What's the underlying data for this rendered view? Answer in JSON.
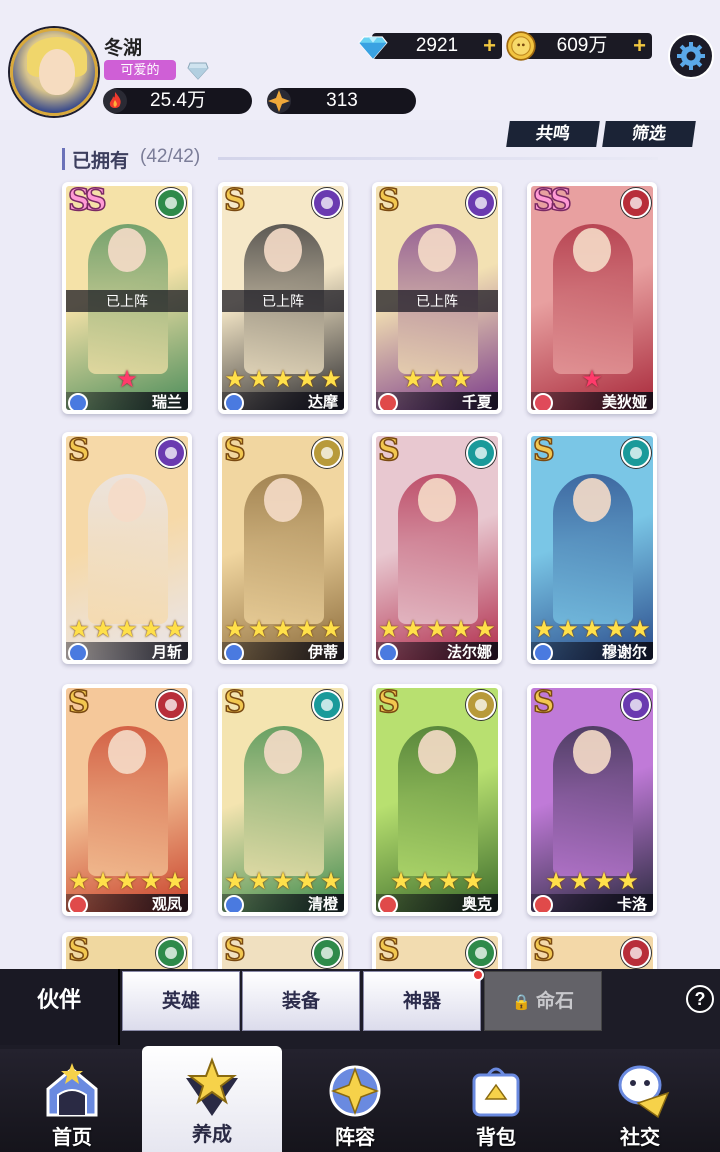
{
  "header": {
    "player_name": "冬湖",
    "player_title": "可爱的",
    "power": "25.4万",
    "rank": "313",
    "gems": "2921",
    "gold": "609万"
  },
  "actions": {
    "resonate": "共鸣",
    "filter": "筛选"
  },
  "owned": {
    "label": "已拥有",
    "count": "(42/42)"
  },
  "heroes": [
    {
      "name": "瑞兰",
      "rarity": "SS",
      "faction": "nature",
      "deployed": "已上阵",
      "stars": 1,
      "star_color": "red",
      "colors": [
        "#f5e2a8",
        "#4a8c5a"
      ]
    },
    {
      "name": "达摩",
      "rarity": "S",
      "faction": "moon",
      "deployed": "已上阵",
      "stars": 5,
      "star_color": "gold",
      "colors": [
        "#f6e8c8",
        "#2a2a2e"
      ]
    },
    {
      "name": "千夏",
      "rarity": "S",
      "faction": "moon",
      "deployed": "已上阵",
      "stars": 3,
      "star_color": "gold",
      "colors": [
        "#f3e1b3",
        "#7a3a8a"
      ]
    },
    {
      "name": "美狄娅",
      "rarity": "SS",
      "faction": "fire",
      "deployed": "",
      "stars": 1,
      "star_color": "red",
      "colors": [
        "#e8a0a0",
        "#a8283a"
      ]
    },
    {
      "name": "月斩",
      "rarity": "S",
      "faction": "moon",
      "deployed": "",
      "stars": 5,
      "star_color": "gold",
      "colors": [
        "#f6d9a8",
        "#e8e6ee"
      ]
    },
    {
      "name": "伊蒂",
      "rarity": "S",
      "faction": "light",
      "deployed": "",
      "stars": 5,
      "star_color": "gold",
      "colors": [
        "#f1d6a0",
        "#8a6a3a"
      ]
    },
    {
      "name": "法尔娜",
      "rarity": "S",
      "faction": "water",
      "deployed": "",
      "stars": 5,
      "star_color": "gold",
      "colors": [
        "#e8c8d0",
        "#b02a4a"
      ]
    },
    {
      "name": "穆谢尔",
      "rarity": "S",
      "faction": "water",
      "deployed": "",
      "stars": 5,
      "star_color": "gold",
      "colors": [
        "#7ac6e6",
        "#2a4a8a"
      ]
    },
    {
      "name": "观凤",
      "rarity": "S",
      "faction": "fire",
      "deployed": "",
      "stars": 5,
      "star_color": "gold",
      "colors": [
        "#f5c89a",
        "#c8402a"
      ]
    },
    {
      "name": "清橙",
      "rarity": "S",
      "faction": "water",
      "deployed": "",
      "stars": 5,
      "star_color": "gold",
      "colors": [
        "#f4e4b0",
        "#3a8a4a"
      ]
    },
    {
      "name": "奥克",
      "rarity": "S",
      "faction": "light",
      "deployed": "",
      "stars": 4,
      "star_color": "gold",
      "colors": [
        "#b8e070",
        "#3a6a2a"
      ]
    },
    {
      "name": "卡洛",
      "rarity": "S",
      "faction": "moon",
      "deployed": "",
      "stars": 4,
      "star_color": "gold",
      "colors": [
        "#c07ad8",
        "#2a2a3e"
      ]
    },
    {
      "name": "",
      "rarity": "S",
      "faction": "nature",
      "deployed": "",
      "stars": 0,
      "star_color": "gold",
      "colors": [
        "#f0d8a0",
        "#4a7a4a"
      ]
    },
    {
      "name": "",
      "rarity": "S",
      "faction": "nature",
      "deployed": "",
      "stars": 0,
      "star_color": "gold",
      "colors": [
        "#f0e0c0",
        "#6a6a6a"
      ]
    },
    {
      "name": "",
      "rarity": "S",
      "faction": "nature",
      "deployed": "",
      "stars": 0,
      "star_color": "gold",
      "colors": [
        "#f2dcb0",
        "#8a7a4a"
      ]
    },
    {
      "name": "",
      "rarity": "S",
      "faction": "fire",
      "deployed": "",
      "stars": 0,
      "star_color": "gold",
      "colors": [
        "#f3d8a8",
        "#9a3a3a"
      ]
    }
  ],
  "faction_colors": {
    "nature": "#2e8a4a",
    "moon": "#6a3ab0",
    "fire": "#b82e3a",
    "light": "#b89a3a",
    "water": "#1a9a9a"
  },
  "class_colors": [
    "#4a7ae0",
    "#4a7ae0",
    "#e04a4a",
    "#e04a5a",
    "#4a7ae0",
    "#4a7ae0",
    "#4a7ae0",
    "#4a7ae0",
    "#e04a4a",
    "#4a7ae0",
    "#e04a4a",
    "#e04a4a",
    "#4a7ae0",
    "#4a7ae0",
    "#4a7ae0",
    "#e04a4a"
  ],
  "subtabs": {
    "active": "伙伴",
    "heroes": "英雄",
    "equipment": "装备",
    "artifact": "神器",
    "fate_stone": "命石"
  },
  "nav": [
    {
      "label": "首页",
      "icon": "home-icon"
    },
    {
      "label": "养成",
      "icon": "cultivate-icon"
    },
    {
      "label": "阵容",
      "icon": "formation-icon"
    },
    {
      "label": "背包",
      "icon": "bag-icon"
    },
    {
      "label": "社交",
      "icon": "social-icon"
    }
  ]
}
